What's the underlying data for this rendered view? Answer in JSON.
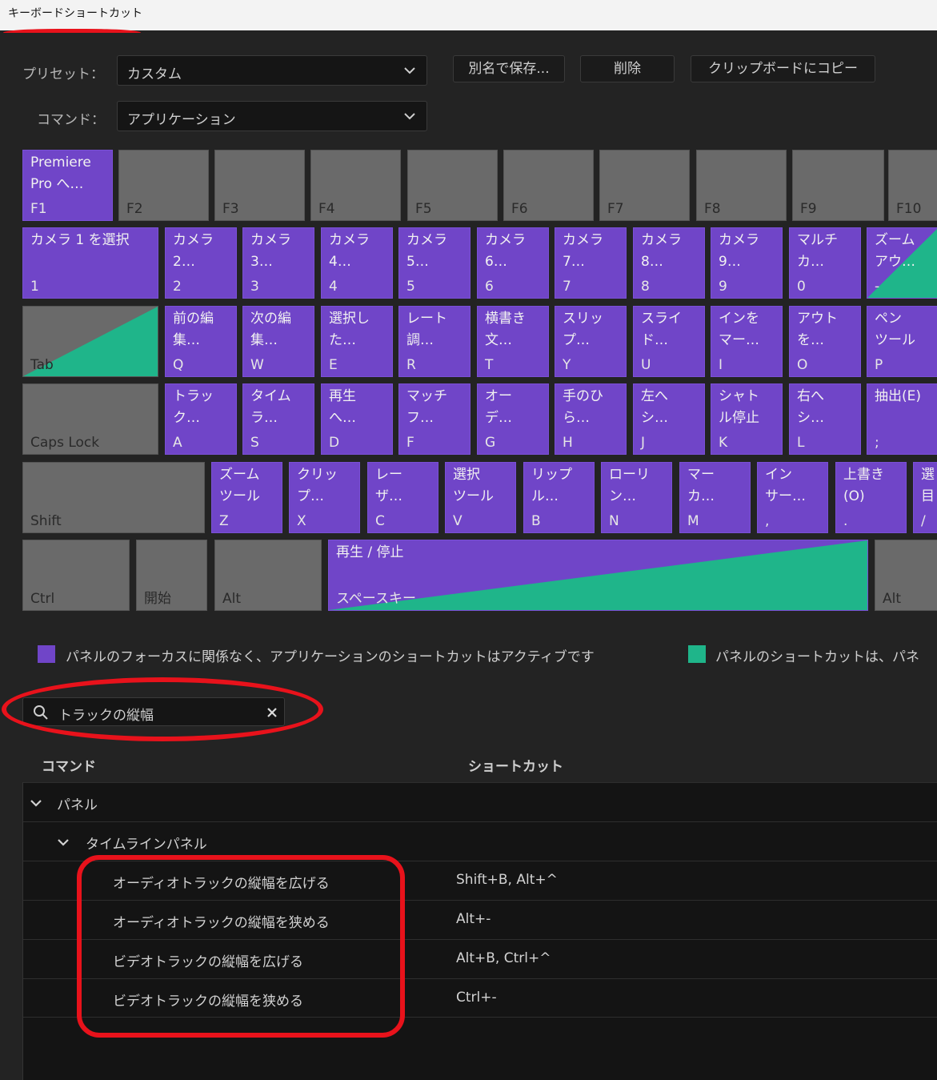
{
  "window": {
    "title": "キーボードショートカット"
  },
  "toolbar": {
    "preset_label": "プリセット：",
    "preset_value": "カスタム",
    "command_label": "コマンド：",
    "command_value": "アプリケーション",
    "save_as": "別名で保存...",
    "delete": "削除",
    "copy_clipboard": "クリップボードにコピー"
  },
  "keyboard": {
    "fn": [
      {
        "cmd": "Premiere\nPro へ…",
        "key": "F1"
      },
      {
        "cmd": "",
        "key": "F2"
      },
      {
        "cmd": "",
        "key": "F3"
      },
      {
        "cmd": "",
        "key": "F4"
      },
      {
        "cmd": "",
        "key": "F5"
      },
      {
        "cmd": "",
        "key": "F6"
      },
      {
        "cmd": "",
        "key": "F7"
      },
      {
        "cmd": "",
        "key": "F8"
      },
      {
        "cmd": "",
        "key": "F9"
      },
      {
        "cmd": "",
        "key": "F10"
      }
    ],
    "num": [
      {
        "cmd": "カメラ 1 を選択",
        "key": "1"
      },
      {
        "cmd": "カメラ\n2…",
        "key": "2"
      },
      {
        "cmd": "カメラ\n3…",
        "key": "3"
      },
      {
        "cmd": "カメラ\n4…",
        "key": "4"
      },
      {
        "cmd": "カメラ\n5…",
        "key": "5"
      },
      {
        "cmd": "カメラ\n6…",
        "key": "6"
      },
      {
        "cmd": "カメラ\n7…",
        "key": "7"
      },
      {
        "cmd": "カメラ\n8…",
        "key": "8"
      },
      {
        "cmd": "カメラ\n9…",
        "key": "9"
      },
      {
        "cmd": "マルチ\nカ…",
        "key": "0"
      },
      {
        "cmd": "ズーム\nアウ…",
        "key": "-"
      }
    ],
    "qrow": [
      {
        "cmd": "",
        "key": "Tab"
      },
      {
        "cmd": "前の編\n集…",
        "key": "Q"
      },
      {
        "cmd": "次の編\n集…",
        "key": "W"
      },
      {
        "cmd": "選択し\nた…",
        "key": "E"
      },
      {
        "cmd": "レート\n調…",
        "key": "R"
      },
      {
        "cmd": "横書き\n文…",
        "key": "T"
      },
      {
        "cmd": "スリッ\nプ…",
        "key": "Y"
      },
      {
        "cmd": "スライ\nド…",
        "key": "U"
      },
      {
        "cmd": "インを\nマー…",
        "key": "I"
      },
      {
        "cmd": "アウト\nを…",
        "key": "O"
      },
      {
        "cmd": "ペン\nツール",
        "key": "P"
      }
    ],
    "arow": [
      {
        "cmd": "",
        "key": "Caps Lock"
      },
      {
        "cmd": "トラッ\nク…",
        "key": "A"
      },
      {
        "cmd": "タイム\nラ…",
        "key": "S"
      },
      {
        "cmd": "再生\nへ…",
        "key": "D"
      },
      {
        "cmd": "マッチ\nフ…",
        "key": "F"
      },
      {
        "cmd": "オー\nデ…",
        "key": "G"
      },
      {
        "cmd": "手のひ\nら…",
        "key": "H"
      },
      {
        "cmd": "左へ\nシ…",
        "key": "J"
      },
      {
        "cmd": "シャト\nル停止",
        "key": "K"
      },
      {
        "cmd": "右へ\nシ…",
        "key": "L"
      },
      {
        "cmd": "抽出(E)",
        "key": ";"
      }
    ],
    "zrow": [
      {
        "cmd": "",
        "key": "Shift"
      },
      {
        "cmd": "ズーム\nツール",
        "key": "Z"
      },
      {
        "cmd": "クリッ\nプ…",
        "key": "X"
      },
      {
        "cmd": "レー\nザ…",
        "key": "C"
      },
      {
        "cmd": "選択\nツール",
        "key": "V"
      },
      {
        "cmd": "リップ\nル…",
        "key": "B"
      },
      {
        "cmd": "ローリ\nン…",
        "key": "N"
      },
      {
        "cmd": "マー\nカ…",
        "key": "M"
      },
      {
        "cmd": "イン\nサー…",
        "key": ","
      },
      {
        "cmd": "上書き\n(O)",
        "key": "."
      },
      {
        "cmd": "選\n目",
        "key": "/"
      }
    ],
    "bottom": [
      {
        "cmd": "",
        "key": "Ctrl"
      },
      {
        "cmd": "",
        "key": "開始"
      },
      {
        "cmd": "",
        "key": "Alt"
      },
      {
        "cmd": "再生 / 停止",
        "key": "スペースキー"
      },
      {
        "cmd": "",
        "key": "Alt"
      }
    ]
  },
  "legend": {
    "app": "パネルのフォーカスに関係なく、アプリケーションのショートカットはアクティブです",
    "panel": "パネルのショートカットは、パネ"
  },
  "search": {
    "value": "トラックの縦幅"
  },
  "table": {
    "col_command": "コマンド",
    "col_shortcut": "ショートカット",
    "group": "パネル",
    "subgroup": "タイムラインパネル",
    "rows": [
      {
        "command": "オーディオトラックの縦幅を広げる",
        "shortcut": "Shift+B, Alt+^"
      },
      {
        "command": "オーディオトラックの縦幅を狭める",
        "shortcut": "Alt+-"
      },
      {
        "command": "ビデオトラックの縦幅を広げる",
        "shortcut": "Alt+B, Ctrl+^"
      },
      {
        "command": "ビデオトラックの縦幅を狭める",
        "shortcut": "Ctrl+-"
      }
    ]
  },
  "colors": {
    "application": "#7045c8",
    "panel": "#1fb58a",
    "annotation": "#e8121b"
  }
}
